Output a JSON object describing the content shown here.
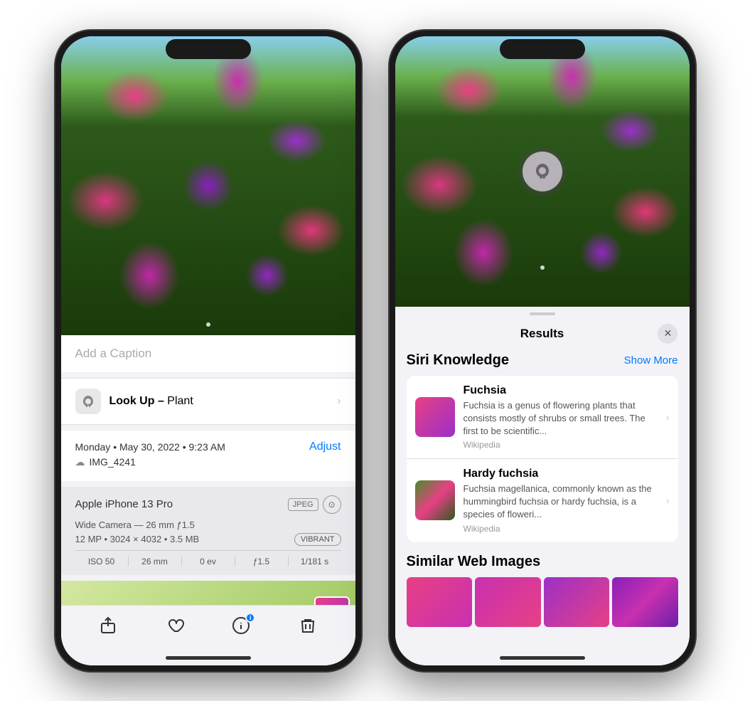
{
  "left_phone": {
    "caption_placeholder": "Add a Caption",
    "lookup": {
      "label": "Look Up –",
      "subject": "Plant",
      "chevron": "›"
    },
    "meta": {
      "date": "Monday • May 30, 2022 • 9:23 AM",
      "adjust_label": "Adjust",
      "filename": "IMG_4241"
    },
    "device": {
      "name": "Apple iPhone 13 Pro",
      "format": "JPEG",
      "camera": "Wide Camera — 26 mm ƒ1.5",
      "mp": "12 MP • 3024 × 4032 • 3.5 MB",
      "style": "VIBRANT",
      "iso": "ISO 50",
      "focal": "26 mm",
      "ev": "0 ev",
      "aperture": "ƒ1.5",
      "shutter": "1/181 s"
    },
    "toolbar": {
      "share": "⎙",
      "like": "♡",
      "info": "ℹ",
      "delete": "🗑"
    }
  },
  "right_phone": {
    "results": {
      "title": "Results",
      "close": "✕",
      "siri_knowledge": "Siri Knowledge",
      "show_more": "Show More",
      "items": [
        {
          "name": "Fuchsia",
          "description": "Fuchsia is a genus of flowering plants that consists mostly of shrubs or small trees. The first to be scientific...",
          "source": "Wikipedia"
        },
        {
          "name": "Hardy fuchsia",
          "description": "Fuchsia magellanica, commonly known as the hummingbird fuchsia or hardy fuchsia, is a species of floweri...",
          "source": "Wikipedia"
        }
      ],
      "similar_web_images": "Similar Web Images"
    }
  }
}
